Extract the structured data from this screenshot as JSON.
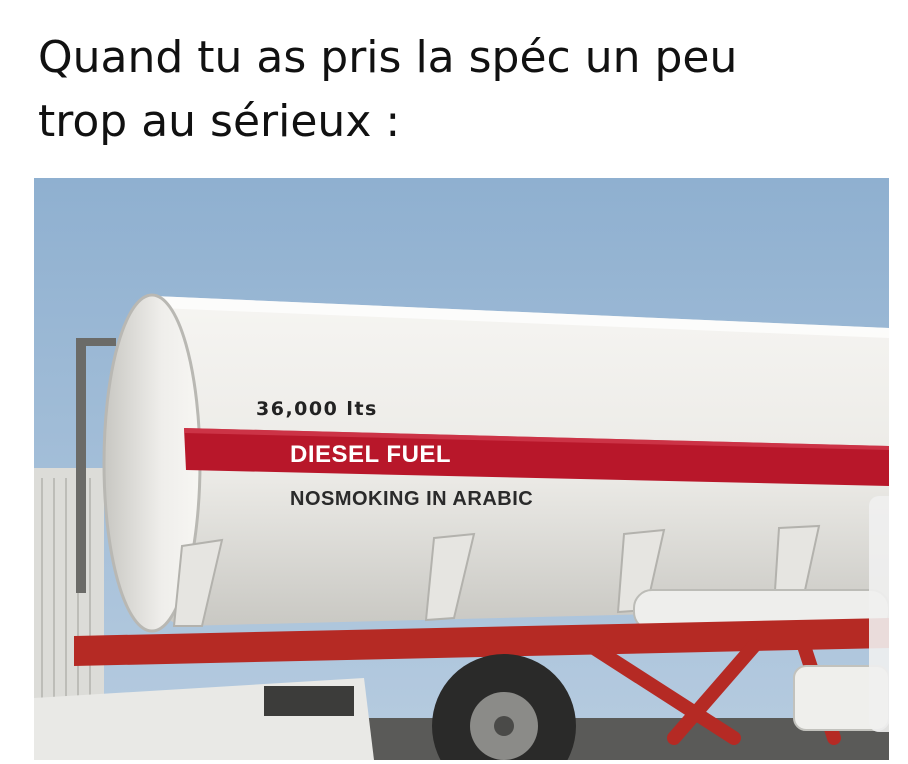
{
  "meme": {
    "caption_line1": "Quand tu as pris la spéc un peu",
    "caption_line2": "trop au sérieux :"
  },
  "tanker": {
    "capacity_text": "36,000 lts",
    "product_text": "DIESEL FUEL",
    "notice_text": "NOSMOKING IN ARABIC",
    "colors": {
      "sky": "#9dbad6",
      "tank_body": "#ecebe8",
      "stripe": "#b8172a",
      "chassis": "#b52a24"
    }
  }
}
